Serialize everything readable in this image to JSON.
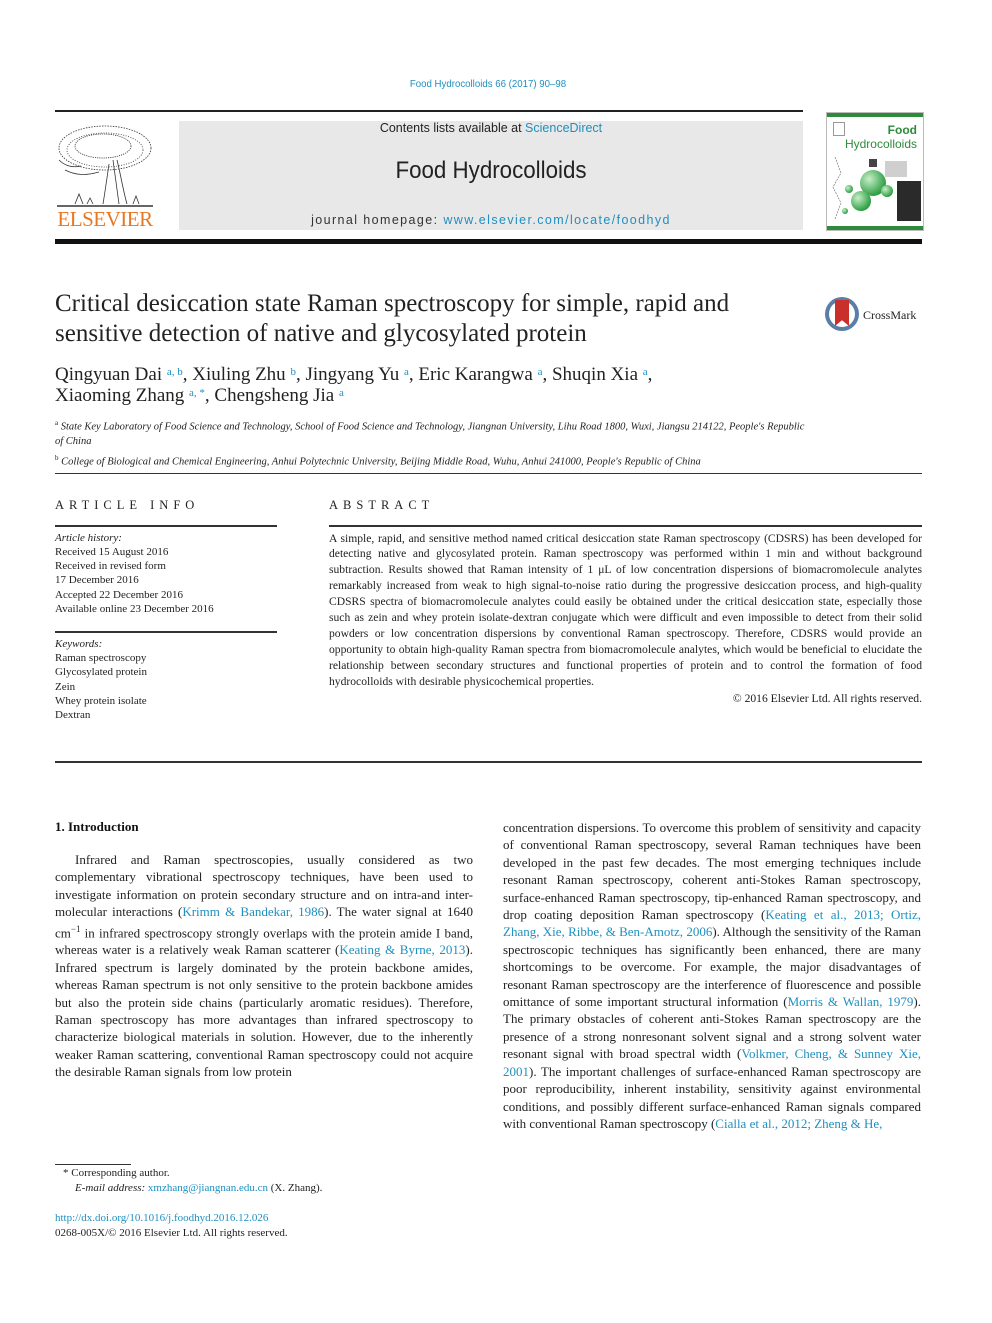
{
  "running_head": "Food Hydrocolloids 66 (2017) 90–98",
  "masthead": {
    "publisher": "ELSEVIER",
    "contents_prefix": "Contents lists available at ",
    "contents_link": "ScienceDirect",
    "journal_name": "Food Hydrocolloids",
    "homepage_prefix": "journal homepage: ",
    "homepage_link": "www.elsevier.com/locate/foodhyd",
    "cover": {
      "title_line1": "Food",
      "title_line2": "Hydrocolloids"
    },
    "colors": {
      "link": "#1f8fbf",
      "elsevier": "#e87722",
      "cover_green": "#2e8b3a"
    }
  },
  "article": {
    "title": "Critical desiccation state Raman spectroscopy for simple, rapid and sensitive detection of native and glycosylated protein",
    "crossmark_label": "CrossMark",
    "authors": [
      {
        "name": "Qingyuan Dai",
        "sup": "a, b",
        "sep": ", "
      },
      {
        "name": "Xiuling Zhu",
        "sup": "b",
        "sep": ", "
      },
      {
        "name": "Jingyang Yu",
        "sup": "a",
        "sep": ", "
      },
      {
        "name": "Eric Karangwa",
        "sup": "a",
        "sep": ", "
      },
      {
        "name": "Shuqin Xia",
        "sup": "a",
        "sep": ","
      },
      {
        "name": "Xiaoming Zhang",
        "sup": "a, *",
        "sep": ", "
      },
      {
        "name": "Chengsheng Jia",
        "sup": "a",
        "sep": ""
      }
    ],
    "affiliations": [
      {
        "key": "a",
        "text": "State Key Laboratory of Food Science and Technology, School of Food Science and Technology, Jiangnan University, Lihu Road 1800, Wuxi, Jiangsu 214122, People's Republic of China"
      },
      {
        "key": "b",
        "text": "College of Biological and Chemical Engineering, Anhui Polytechnic University, Beijing Middle Road, Wuhu, Anhui 241000, People's Republic of China"
      }
    ]
  },
  "article_info": {
    "heading": "ARTICLE INFO",
    "history_label": "Article history:",
    "history": [
      "Received 15 August 2016",
      "Received in revised form",
      "17 December 2016",
      "Accepted 22 December 2016",
      "Available online 23 December 2016"
    ],
    "keywords_label": "Keywords:",
    "keywords": [
      "Raman spectroscopy",
      "Glycosylated protein",
      "Zein",
      "Whey protein isolate",
      "Dextran"
    ]
  },
  "abstract": {
    "heading": "ABSTRACT",
    "text": "A simple, rapid, and sensitive method named critical desiccation state Raman spectroscopy (CDSRS) has been developed for detecting native and glycosylated protein. Raman spectroscopy was performed within 1 min and without background subtraction. Results showed that Raman intensity of 1 μL of low concentration dispersions of biomacromolecule analytes remarkably increased from weak to high signal-to-noise ratio during the progressive desiccation process, and high-quality CDSRS spectra of biomacromolecule analytes could easily be obtained under the critical desiccation state, especially those such as zein and whey protein isolate-dextran conjugate which were difficult and even impossible to detect from their solid powders or low concentration dispersions by conventional Raman spectroscopy. Therefore, CDSRS would provide an opportunity to obtain high-quality Raman spectra from biomacromolecule analytes, which would be beneficial to elucidate the relationship between secondary structures and functional properties of protein and to control the formation of food hydrocolloids with desirable physicochemical properties.",
    "copyright": "© 2016 Elsevier Ltd. All rights reserved."
  },
  "introduction": {
    "heading": "1.  Introduction",
    "left": {
      "t1": "Infrared and Raman spectroscopies, usually considered as two complementary vibrational spectroscopy techniques, have been used to investigate information on protein secondary structure and on intra-and inter-molecular interactions (",
      "c1": "Krimm & Bandekar, 1986",
      "t2": "). The water signal at 1640 cm",
      "sup": "−1",
      "t3": " in infrared spectroscopy strongly overlaps with the protein amide I band, whereas water is a relatively weak Raman scatterer (",
      "c2": "Keating & Byrne, 2013",
      "t4": "). Infrared spectrum is largely dominated by the protein backbone amides, whereas Raman spectrum is not only sensitive to the protein backbone amides but also the protein side chains (particularly aromatic residues). Therefore, Raman spectroscopy has more advantages than infrared spectroscopy to characterize biological materials in solution. However, due to the inherently weaker Raman scattering, conventional Raman spectroscopy could not acquire the desirable Raman signals from low protein"
    },
    "right": {
      "t1": "concentration dispersions. To overcome this problem of sensitivity and capacity of conventional Raman spectroscopy, several Raman techniques have been developed in the past few decades. The most emerging techniques include resonant Raman spectroscopy, coherent anti-Stokes Raman spectroscopy, surface-enhanced Raman spectroscopy, tip-enhanced Raman spectroscopy, and drop coating deposition Raman spectroscopy (",
      "c1": "Keating et al., 2013; Ortiz, Zhang, Xie, Ribbe, & Ben-Amotz, 2006",
      "t2": "). Although the sensitivity of the Raman spectroscopic techniques has significantly been enhanced, there are many shortcomings to be overcome. For example, the major disadvantages of resonant Raman spectroscopy are the interference of fluorescence and possible omittance of some important structural information (",
      "c2": "Morris & Wallan, 1979",
      "t3": "). The primary obstacles of coherent anti-Stokes Raman spectroscopy are the presence of a strong nonresonant solvent signal and a strong solvent water resonant signal with broad spectral width (",
      "c3": "Volkmer, Cheng, & Sunney Xie, 2001",
      "t4": "). The important challenges of surface-enhanced Raman spectroscopy are poor reproducibility, inherent instability, sensitivity against environmental conditions, and possibly different surface-enhanced Raman signals compared with conventional Raman spectroscopy (",
      "c4": "Cialla et al., 2012; Zheng & He,"
    }
  },
  "footnotes": {
    "corresponding": "*  Corresponding author.",
    "email_label": "E-mail address: ",
    "email": "xmzhang@jiangnan.edu.cn",
    "email_suffix": " (X. Zhang).",
    "doi": "http://dx.doi.org/10.1016/j.foodhyd.2016.12.026",
    "issn": "0268-005X/© 2016 Elsevier Ltd. All rights reserved."
  }
}
